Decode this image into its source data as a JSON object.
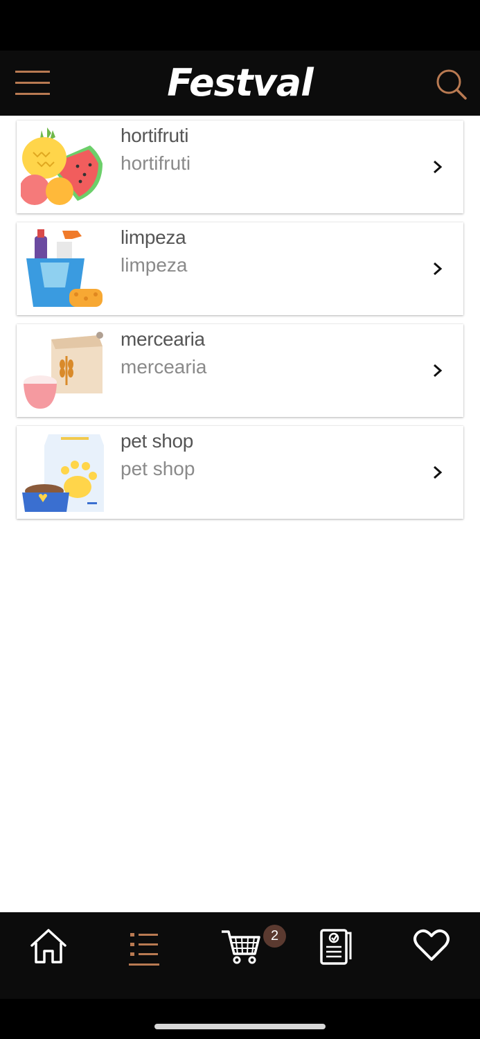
{
  "header": {
    "brand": "Festval",
    "menu_icon": "hamburger-menu-icon",
    "search_icon": "search-icon",
    "accent_color": "#b97a52"
  },
  "categories": [
    {
      "title": "hortifruti",
      "subtitle": "hortifruti",
      "image": "fruits-illustration"
    },
    {
      "title": "limpeza",
      "subtitle": "limpeza",
      "image": "cleaning-supplies-illustration"
    },
    {
      "title": "mercearia",
      "subtitle": "mercearia",
      "image": "grocery-bag-illustration"
    },
    {
      "title": "pet shop",
      "subtitle": "pet shop",
      "image": "pet-food-illustration"
    }
  ],
  "bottom_nav": {
    "items": [
      {
        "icon": "home-icon",
        "active": false
      },
      {
        "icon": "list-icon",
        "active": true
      },
      {
        "icon": "cart-icon",
        "active": false
      },
      {
        "icon": "orders-icon",
        "active": false
      },
      {
        "icon": "heart-icon",
        "active": false
      }
    ],
    "cart_badge": "2",
    "active_color": "#b97a52"
  }
}
